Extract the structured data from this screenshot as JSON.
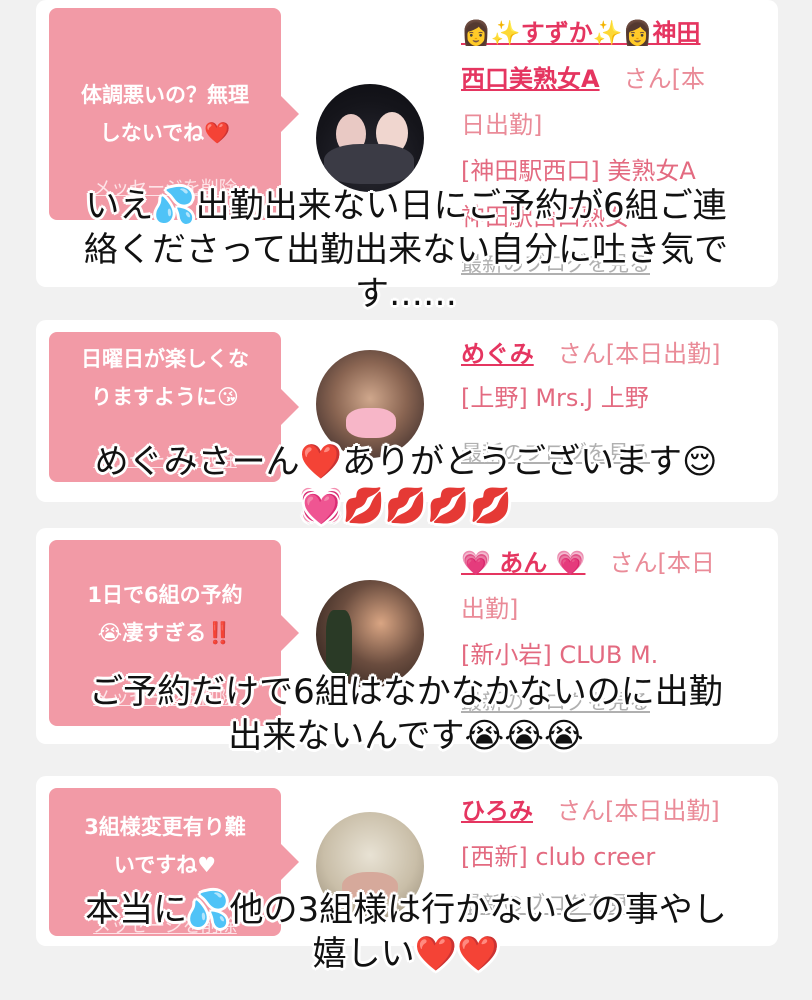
{
  "cards": [
    {
      "message": "体調悪いの？無理しないでね❤️",
      "message_line1": "体調悪いの？無理",
      "message_line2": "しないでね❤️",
      "delete_label": "メッセージを削除",
      "name": "👩✨すずか✨👩神田西口美熟女A",
      "name_line1": "👩✨すずか✨👩神田",
      "name_line2": "西口美熟女A",
      "san_label": "さん[本",
      "status_cont": "日出勤]",
      "shop": "[神田駅西口] 美熟女A",
      "shop2": "神田駅西口熟女",
      "blog_label": "最新のブログを見る"
    },
    {
      "message_line1": "日曜日が楽しくな",
      "message_line2": "りますように😘",
      "delete_label": "メッセージを削除",
      "name": "めぐみ",
      "san_label": "さん[本日出勤]",
      "shop": "[上野] Mrs.J 上野",
      "blog_label": "最新のブログを見る"
    },
    {
      "message_line1": "1日で6組の予約",
      "message_line2": "😭凄すぎる‼️",
      "delete_label": "メッセージを削除",
      "name": "💗 あん 💗",
      "san_label": "さん[本日",
      "status_cont": "出勤]",
      "shop": "[新小岩] CLUB M.",
      "blog_label": "最新のブログを見る"
    },
    {
      "message_line1": "3組様変更有り難",
      "message_line2": "いですね♥",
      "delete_label": "メッセージを削除",
      "name": "ひろみ",
      "san_label": "さん[本日出勤]",
      "shop": "[西新] club creer",
      "blog_label": "最新のブログを見る"
    }
  ],
  "captions": [
    {
      "line1": "いえ💦出勤出来ない日にご予約が6組ご連",
      "line2": "絡くださって出勤出来ない自分に吐き気で",
      "line3": "す……"
    },
    {
      "line1": "めぐみさーん❤️ありがとうございます😌",
      "line2": "💓💋💋💋💋"
    },
    {
      "line1": "ご予約だけで6組はなかなかないのに出勤",
      "line2": "出来ないんです😭😭😭"
    },
    {
      "line1": "本当に💦他の3組様は行かないとの事やし",
      "line2": "嬉しい❤️❤️"
    }
  ],
  "colors": {
    "bubble": "#f29aa6",
    "name": "#e53560",
    "san": "#ea8b98",
    "shop": "#e36a80",
    "link": "#b0b0b0",
    "background": "#f1f1f1"
  }
}
